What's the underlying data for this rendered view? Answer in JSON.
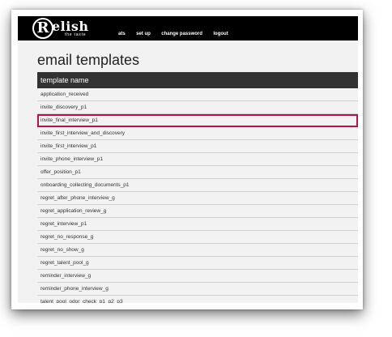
{
  "brand": {
    "logo_letter": "R",
    "logo_word": "elish",
    "tagline": "the taste"
  },
  "nav": [
    "ats",
    "set up",
    "change password",
    "logout"
  ],
  "page": {
    "title": "email templates"
  },
  "table": {
    "header": "template name",
    "rows": [
      "application_received",
      "invite_discovery_p1",
      "invite_final_interview_p1",
      "invite_first_interview_and_discovery",
      "invite_first_interview_p1",
      "invite_phone_interview_p1",
      "offer_position_p1",
      "onboarding_collecting_documents_p1",
      "regret_after_phone_interview_g",
      "regret_application_review_g",
      "regret_interview_p1",
      "regret_no_response_g",
      "regret_no_show_g",
      "regret_talent_pool_g",
      "reminder_interview_g",
      "reminder_phone_interview_g",
      "talent_pool_odor_check_p1_p2_p3"
    ],
    "highlighted_row": "invite_final_interview_p1",
    "highlight_color": "#b3124b"
  }
}
